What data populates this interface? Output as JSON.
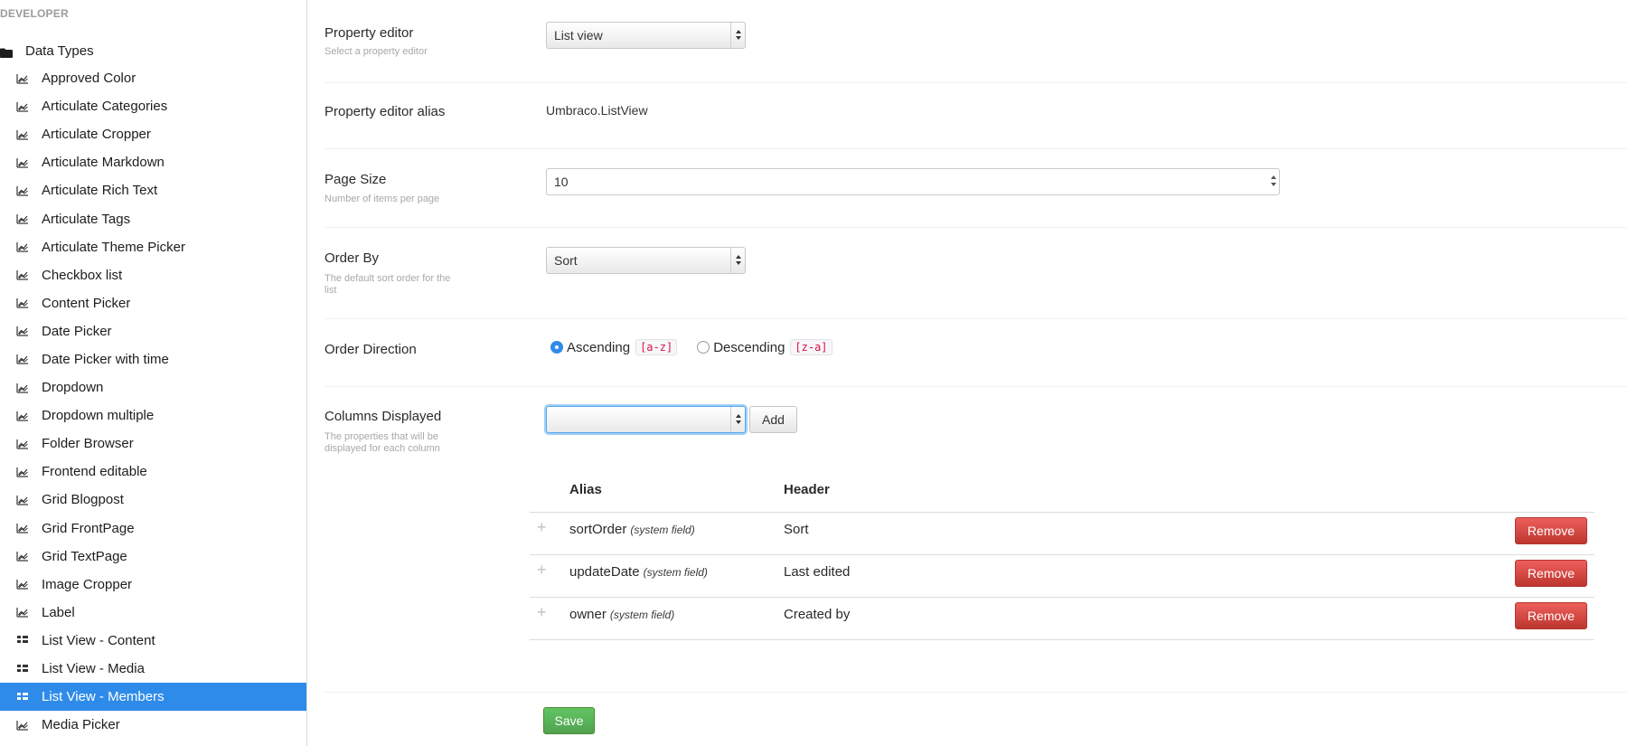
{
  "sidebar": {
    "section_title": "DEVELOPER",
    "root_label": "Data Types",
    "items": [
      {
        "label": "Approved Color",
        "icon": "chart-icon"
      },
      {
        "label": "Articulate Categories",
        "icon": "chart-icon"
      },
      {
        "label": "Articulate Cropper",
        "icon": "chart-icon"
      },
      {
        "label": "Articulate Markdown",
        "icon": "chart-icon"
      },
      {
        "label": "Articulate Rich Text",
        "icon": "chart-icon"
      },
      {
        "label": "Articulate Tags",
        "icon": "chart-icon"
      },
      {
        "label": "Articulate Theme Picker",
        "icon": "chart-icon"
      },
      {
        "label": "Checkbox list",
        "icon": "chart-icon"
      },
      {
        "label": "Content Picker",
        "icon": "chart-icon"
      },
      {
        "label": "Date Picker",
        "icon": "chart-icon"
      },
      {
        "label": "Date Picker with time",
        "icon": "chart-icon"
      },
      {
        "label": "Dropdown",
        "icon": "chart-icon"
      },
      {
        "label": "Dropdown multiple",
        "icon": "chart-icon"
      },
      {
        "label": "Folder Browser",
        "icon": "chart-icon"
      },
      {
        "label": "Frontend editable",
        "icon": "chart-icon"
      },
      {
        "label": "Grid Blogpost",
        "icon": "chart-icon"
      },
      {
        "label": "Grid FrontPage",
        "icon": "chart-icon"
      },
      {
        "label": "Grid TextPage",
        "icon": "chart-icon"
      },
      {
        "label": "Image Cropper",
        "icon": "chart-icon"
      },
      {
        "label": "Label",
        "icon": "chart-icon"
      },
      {
        "label": "List View - Content",
        "icon": "grid-icon"
      },
      {
        "label": "List View - Media",
        "icon": "grid-icon"
      },
      {
        "label": "List View - Members",
        "icon": "grid-icon",
        "active": true
      },
      {
        "label": "Media Picker",
        "icon": "chart-icon"
      }
    ]
  },
  "form": {
    "property_editor": {
      "label": "Property editor",
      "description": "Select a property editor",
      "value": "List view"
    },
    "property_editor_alias": {
      "label": "Property editor alias",
      "value": "Umbraco.ListView"
    },
    "page_size": {
      "label": "Page Size",
      "description": "Number of items per page",
      "value": "10"
    },
    "order_by": {
      "label": "Order By",
      "description": "The default sort order for the list",
      "value": "Sort"
    },
    "order_direction": {
      "label": "Order Direction",
      "options": [
        {
          "label": "Ascending",
          "code": "[a-z]",
          "checked": true
        },
        {
          "label": "Descending",
          "code": "[z-a]",
          "checked": false
        }
      ]
    },
    "columns_displayed": {
      "label": "Columns Displayed",
      "description": "The properties that will be displayed for each column",
      "select_value": "",
      "add_label": "Add",
      "headers": {
        "alias": "Alias",
        "header": "Header"
      },
      "rows": [
        {
          "alias": "sortOrder",
          "note": "(system field)",
          "header": "Sort",
          "remove_label": "Remove"
        },
        {
          "alias": "updateDate",
          "note": "(system field)",
          "header": "Last edited",
          "remove_label": "Remove"
        },
        {
          "alias": "owner",
          "note": "(system field)",
          "header": "Created by",
          "remove_label": "Remove"
        }
      ]
    },
    "save_label": "Save"
  },
  "colors": {
    "accent": "#2e8be9",
    "danger": "#d9534f",
    "success": "#5cb85c"
  }
}
